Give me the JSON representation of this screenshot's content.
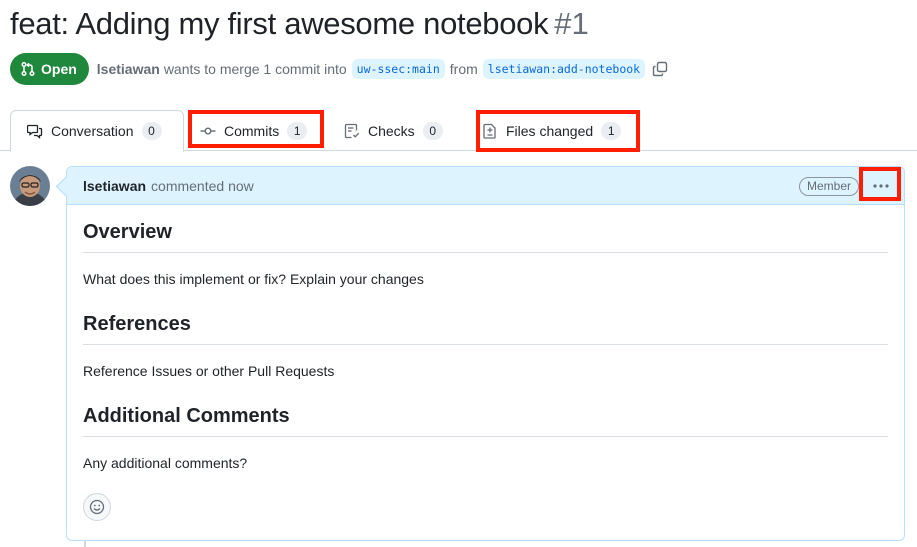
{
  "pr": {
    "title": "feat: Adding my first awesome notebook",
    "number": "#1",
    "state": "Open",
    "author": "lsetiawan",
    "merge_text": "wants to merge 1 commit into",
    "base_branch": "uw-ssec:main",
    "from_text": "from",
    "head_branch": "lsetiawan:add-notebook"
  },
  "tabs": [
    {
      "label": "Conversation",
      "count": "0",
      "icon": "comment-discussion-icon"
    },
    {
      "label": "Commits",
      "count": "1",
      "icon": "git-commit-icon"
    },
    {
      "label": "Checks",
      "count": "0",
      "icon": "checklist-icon"
    },
    {
      "label": "Files changed",
      "count": "1",
      "icon": "file-diff-icon"
    }
  ],
  "comment": {
    "author": "lsetiawan",
    "action": "commented now",
    "role": "Member",
    "sections": [
      {
        "heading": "Overview",
        "text": "What does this implement or fix? Explain your changes"
      },
      {
        "heading": "References",
        "text": "Reference Issues or other Pull Requests"
      },
      {
        "heading": "Additional Comments",
        "text": "Any additional comments?"
      }
    ]
  },
  "colors": {
    "open_green": "#1f883d",
    "link_blue": "#0969da",
    "branch_bg": "#ddf4ff",
    "highlight_red": "#ff1e00"
  }
}
